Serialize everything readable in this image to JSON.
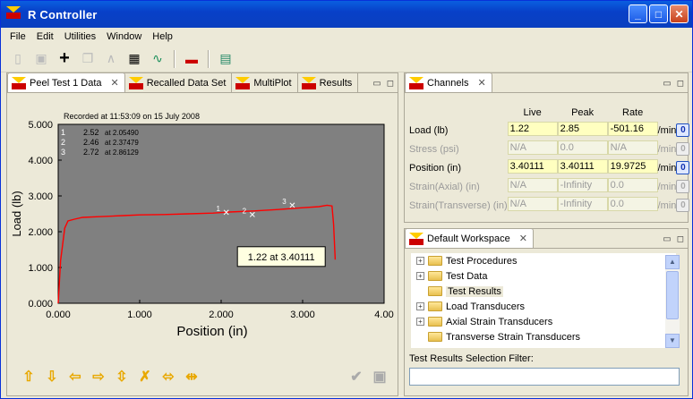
{
  "window": {
    "title": "R Controller"
  },
  "menu": [
    "File",
    "Edit",
    "Utilities",
    "Window",
    "Help"
  ],
  "left_tabs": [
    {
      "label": "Peel Test 1 Data",
      "active": true
    },
    {
      "label": "Recalled Data Set"
    },
    {
      "label": "MultiPlot"
    },
    {
      "label": "Results"
    }
  ],
  "channels_tab": "Channels",
  "workspace_tab": "Default Workspace",
  "chart_data": {
    "type": "line",
    "title": "Recorded at 11:53:09 on 15 July 2008",
    "xlabel": "Position (in)",
    "ylabel": "Load (lb)",
    "xlim": [
      0,
      4.0
    ],
    "ylim": [
      0,
      5.0
    ],
    "xticks": [
      "0.000",
      "1.000",
      "2.000",
      "3.000",
      "4.00"
    ],
    "yticks": [
      "0.000",
      "1.000",
      "2.000",
      "3.000",
      "4.000",
      "5.000"
    ],
    "legend": [
      {
        "n": "1",
        "v": "2.52",
        "at": "at 2.05490"
      },
      {
        "n": "2",
        "v": "2.46",
        "at": "at 2.37479"
      },
      {
        "n": "3",
        "v": "2.72",
        "at": "at 2.86129"
      }
    ],
    "markers": [
      {
        "label": "1",
        "x": 2.05,
        "y": 2.52
      },
      {
        "label": "2",
        "x": 2.37,
        "y": 2.46
      },
      {
        "label": "3",
        "x": 2.86,
        "y": 2.72
      }
    ],
    "tooltip": "1.22  at 3.40111",
    "series": [
      {
        "color": "#ff0000",
        "x": [
          0.0,
          0.03,
          0.08,
          0.12,
          0.2,
          0.3,
          0.5,
          0.8,
          1.0,
          1.3,
          1.6,
          1.9,
          2.1,
          2.4,
          2.7,
          3.0,
          3.2,
          3.3,
          3.36,
          3.38,
          3.4
        ],
        "y": [
          0.0,
          1.2,
          2.1,
          2.3,
          2.35,
          2.4,
          2.42,
          2.45,
          2.47,
          2.48,
          2.5,
          2.52,
          2.55,
          2.58,
          2.62,
          2.67,
          2.7,
          2.74,
          2.72,
          2.2,
          1.22
        ]
      }
    ],
    "grid": false,
    "plot_bg": "#808080"
  },
  "channels": {
    "headers": [
      "Live",
      "Peak",
      "Rate"
    ],
    "rows": [
      {
        "label": "Load (lb)",
        "live": "1.22",
        "peak": "2.85",
        "rate": "-501.16",
        "unit": "/min",
        "dim": false
      },
      {
        "label": "Stress (psi)",
        "live": "N/A",
        "peak": "0.0",
        "rate": "N/A",
        "unit": "/min",
        "dim": true
      },
      {
        "label": "Position (in)",
        "live": "3.40111",
        "peak": "3.40111",
        "rate": "19.9725",
        "unit": "/min",
        "dim": false
      },
      {
        "label": "Strain(Axial) (in)",
        "live": "N/A",
        "peak": "-Infinity",
        "rate": "0.0",
        "unit": "/min",
        "dim": true
      },
      {
        "label": "Strain(Transverse) (in)",
        "live": "N/A",
        "peak": "-Infinity",
        "rate": "0.0",
        "unit": "/min",
        "dim": true
      }
    ],
    "zero_label": "0"
  },
  "workspace": {
    "items": [
      {
        "label": "Test Procedures",
        "expand": true
      },
      {
        "label": "Test Data",
        "expand": true
      },
      {
        "label": "Test Results",
        "expand": false,
        "selected": true
      },
      {
        "label": "Load Transducers",
        "expand": true
      },
      {
        "label": "Axial Strain Transducers",
        "expand": true
      },
      {
        "label": "Transverse Strain Transducers",
        "expand": false
      }
    ],
    "filter_label": "Test Results Selection Filter:",
    "filter_value": ""
  }
}
